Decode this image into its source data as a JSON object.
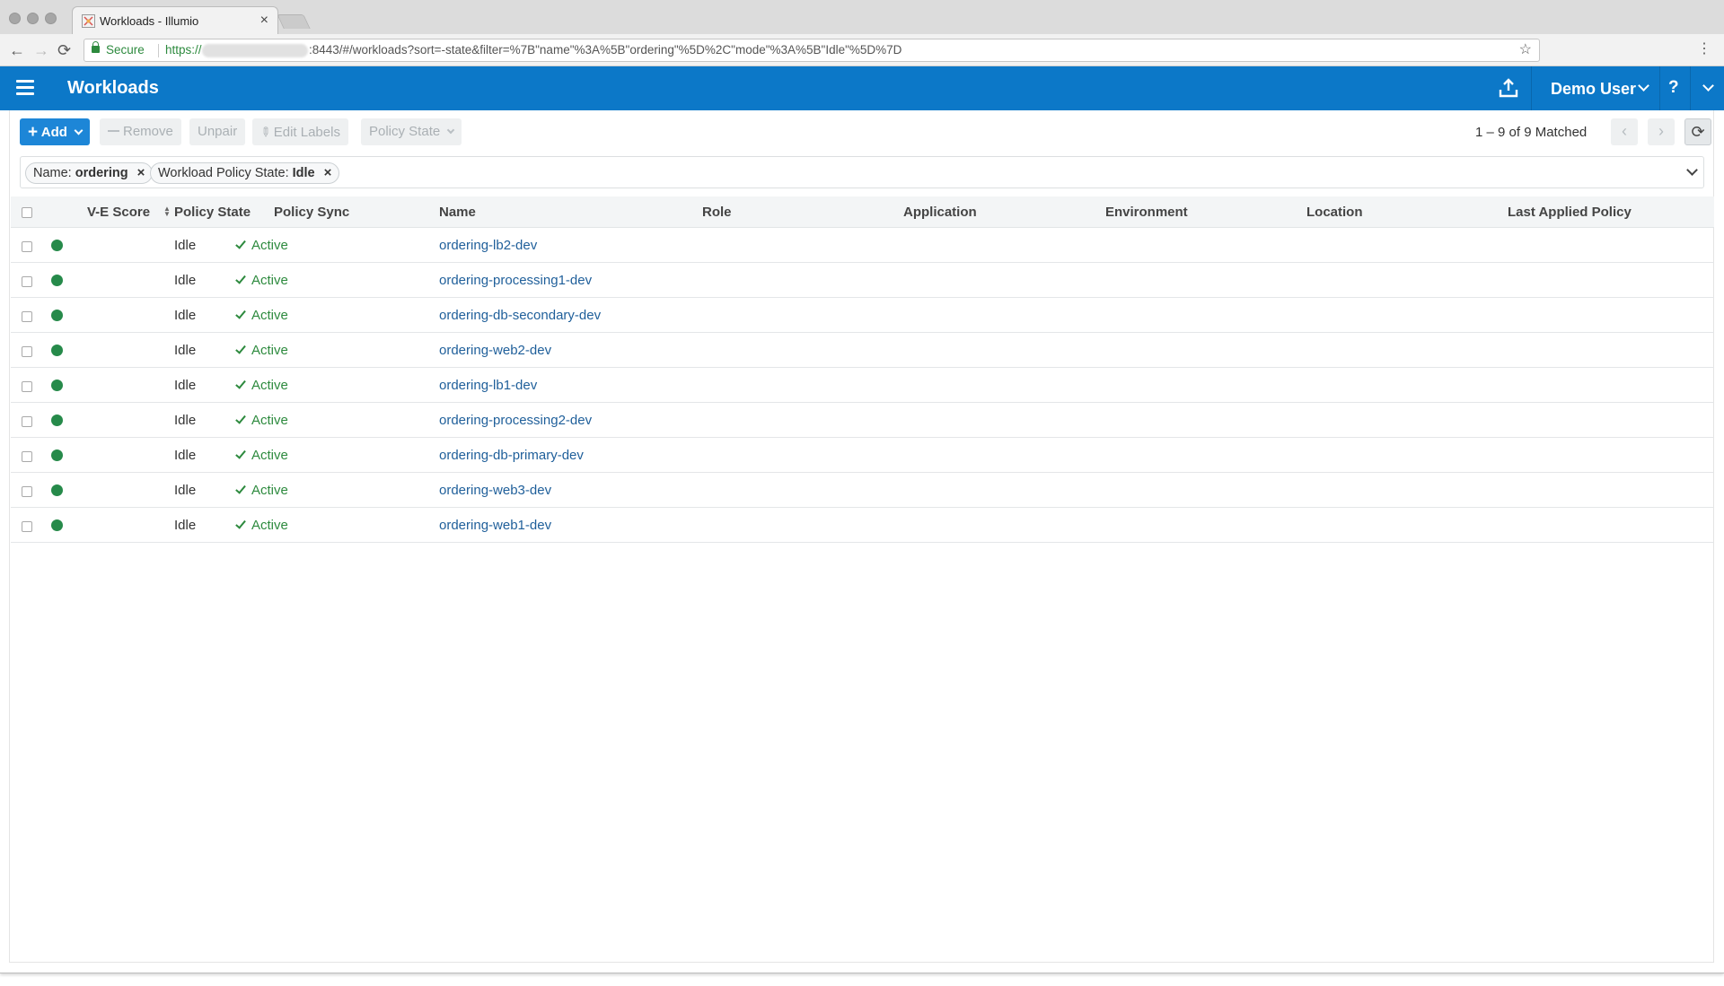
{
  "browser": {
    "tab_title": "Workloads - Illumio",
    "tab_close": "×",
    "secure_label": "Secure",
    "url_scheme": "https://",
    "url_rest": ":8443/#/workloads?sort=-state&filter=%7B\"name\"%3A%5B\"ordering\"%5D%2C\"mode\"%3A%5B\"Idle\"%5D%7D",
    "back": "←",
    "forward": "→",
    "reload": "⟳",
    "star": "☆",
    "menu": "⋮"
  },
  "header": {
    "title": "Workloads",
    "user": "Demo User",
    "help": "?"
  },
  "toolbar": {
    "add_label": "Add",
    "remove_label": "Remove",
    "unpair_label": "Unpair",
    "edit_labels_label": "Edit Labels",
    "policy_state_label": "Policy State",
    "pager_text": "1 – 9 of 9 Matched",
    "prev": "‹",
    "next": "›",
    "refresh": "⟳"
  },
  "filters": [
    {
      "key": "Name:",
      "value": "ordering",
      "remove": "×"
    },
    {
      "key": "Workload Policy State:",
      "value": "Idle",
      "remove": "×"
    }
  ],
  "columns": {
    "ve_score": "V-E Score",
    "policy_state": "Policy State",
    "policy_sync": "Policy Sync",
    "name": "Name",
    "role": "Role",
    "application": "Application",
    "environment": "Environment",
    "location": "Location",
    "last_applied": "Last Applied Policy"
  },
  "rows": [
    {
      "state": "Idle",
      "sync": "Active",
      "name": "ordering-lb2-dev"
    },
    {
      "state": "Idle",
      "sync": "Active",
      "name": "ordering-processing1-dev"
    },
    {
      "state": "Idle",
      "sync": "Active",
      "name": "ordering-db-secondary-dev"
    },
    {
      "state": "Idle",
      "sync": "Active",
      "name": "ordering-web2-dev"
    },
    {
      "state": "Idle",
      "sync": "Active",
      "name": "ordering-lb1-dev"
    },
    {
      "state": "Idle",
      "sync": "Active",
      "name": "ordering-processing2-dev"
    },
    {
      "state": "Idle",
      "sync": "Active",
      "name": "ordering-db-primary-dev"
    },
    {
      "state": "Idle",
      "sync": "Active",
      "name": "ordering-web3-dev"
    },
    {
      "state": "Idle",
      "sync": "Active",
      "name": "ordering-web1-dev"
    }
  ],
  "colors": {
    "brand": "#0c78c8",
    "primary_button": "#1d86d7",
    "status_online": "#268a4a",
    "active_green": "#2d8a3e",
    "link": "#1f5f9a"
  }
}
